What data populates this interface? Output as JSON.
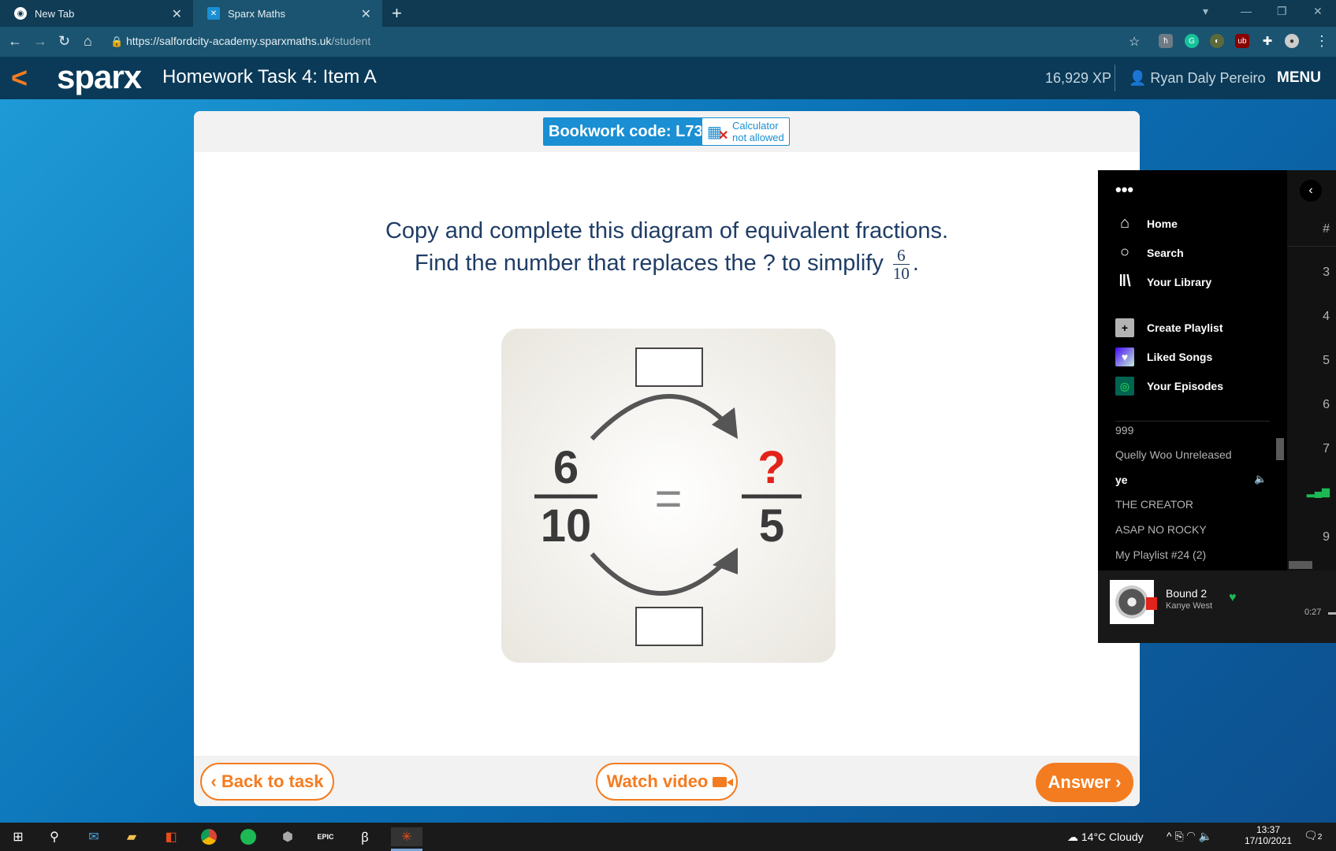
{
  "browser": {
    "tabs": [
      {
        "title": "New Tab",
        "icon": "chrome-icon"
      },
      {
        "title": "Sparx Maths",
        "icon": "sparx-favicon"
      }
    ],
    "url_main": "https://salfordcity-academy.sparxmaths.uk",
    "url_path": "/student"
  },
  "header": {
    "logo": "sparx",
    "title": "Homework Task 4: Item A",
    "xp": "16,929 XP",
    "user": "Ryan Daly Pereiro",
    "menu": "MENU"
  },
  "task": {
    "bookwork_code": "Bookwork code: L73",
    "calculator_line1": "Calculator",
    "calculator_line2": "not allowed",
    "question_line1": "Copy and complete this diagram of equivalent fractions.",
    "question_line2": "Find the number that replaces the ? to simplify",
    "fraction_num": "6",
    "fraction_den": "10",
    "period": ".",
    "diagram": {
      "left_num": "6",
      "left_den": "10",
      "equals": "=",
      "right_num": "?",
      "right_den": "5"
    },
    "back_label": "Back to task",
    "video_label": "Watch video",
    "answer_label": "Answer"
  },
  "spotify": {
    "nav": [
      "Home",
      "Search",
      "Your Library"
    ],
    "actions": [
      "Create Playlist",
      "Liked Songs",
      "Your Episodes"
    ],
    "playlists": [
      "999",
      "Quelly Woo Unreleased",
      "ye",
      "THE CREATOR",
      "ASAP NO ROCKY",
      "My Playlist #24 (2)"
    ],
    "track_numbers": [
      "#",
      "3",
      "4",
      "5",
      "6",
      "7",
      "9"
    ],
    "now_playing": {
      "title": "Bound 2",
      "artist": "Kanye West",
      "time": "0:27"
    }
  },
  "taskbar": {
    "weather": "14°C  Cloudy",
    "time": "13:37",
    "date": "17/10/2021",
    "notifications": "2"
  },
  "colors": {
    "accent_orange": "#f47c20",
    "sparx_blue": "#1a8fd3",
    "spotify_green": "#1db954"
  }
}
